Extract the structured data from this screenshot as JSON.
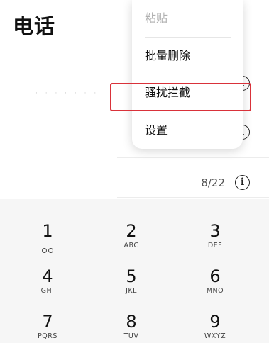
{
  "header": {
    "title": "电话"
  },
  "context_menu": {
    "items": [
      {
        "label": "粘贴",
        "enabled": false
      },
      {
        "label": "批量删除",
        "enabled": true
      },
      {
        "label": "骚扰拦截",
        "enabled": true,
        "highlighted": true
      },
      {
        "label": "设置",
        "enabled": true
      }
    ]
  },
  "call_list": {
    "count_label": "8/22",
    "info_icon": "info-icon"
  },
  "keypad": {
    "keys": [
      {
        "digit": "1",
        "letters": "",
        "icon": "voicemail-icon"
      },
      {
        "digit": "2",
        "letters": "ABC"
      },
      {
        "digit": "3",
        "letters": "DEF"
      },
      {
        "digit": "4",
        "letters": "GHI"
      },
      {
        "digit": "5",
        "letters": "JKL"
      },
      {
        "digit": "6",
        "letters": "MNO"
      },
      {
        "digit": "7",
        "letters": "PQRS"
      },
      {
        "digit": "8",
        "letters": "TUV"
      },
      {
        "digit": "9",
        "letters": "WXYZ"
      }
    ]
  },
  "colors": {
    "highlight_border": "#d9323a",
    "keypad_background": "#f6f6f6",
    "disabled_text": "#b0b0b0"
  }
}
